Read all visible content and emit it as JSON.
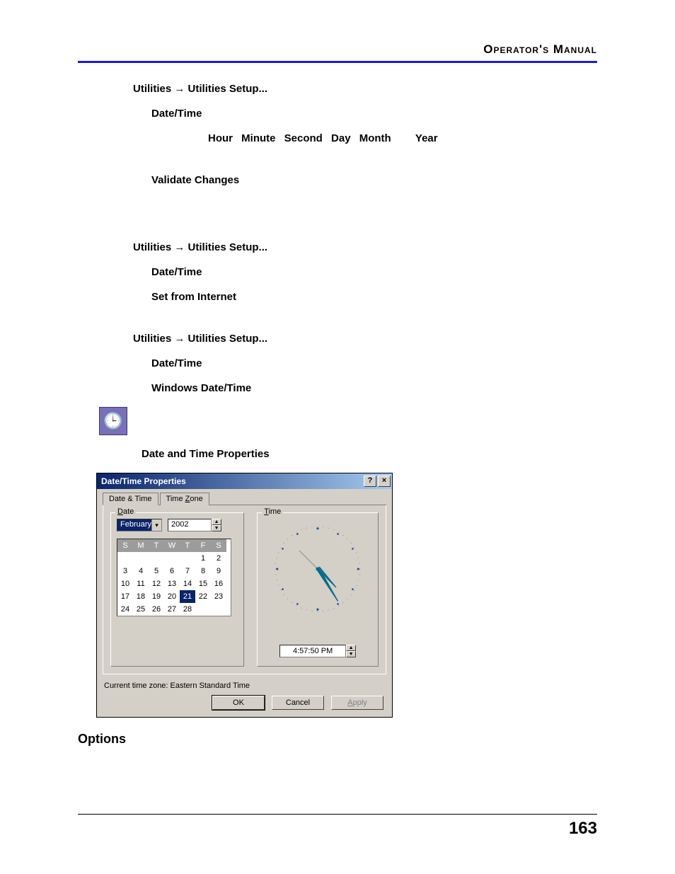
{
  "header": {
    "title": "Operator's Manual"
  },
  "footer": {
    "page_number": "163"
  },
  "section1": {
    "nav": {
      "a": "Utilities",
      "arrow": "→",
      "b": "Utilities Setup..."
    },
    "item1": "Date/Time",
    "time_parts": {
      "hour": "Hour",
      "minute": "Minute",
      "second": "Second",
      "day": "Day",
      "month": "Month",
      "year": "Year"
    },
    "validate": "Validate Changes"
  },
  "section2": {
    "nav": {
      "a": "Utilities",
      "arrow": "→",
      "b": "Utilities Setup..."
    },
    "item1": "Date/Time",
    "item2": "Set from Internet"
  },
  "section3": {
    "nav": {
      "a": "Utilities",
      "arrow": "→",
      "b": "Utilities Setup..."
    },
    "item1": "Date/Time",
    "item2": "Windows Date/Time"
  },
  "props_label": "Date and Time Properties",
  "dialog": {
    "title": "Date/Time Properties",
    "tabs": {
      "active": "Date & Time",
      "other": "Time Zone",
      "other_ul": "Z"
    },
    "date_legend": "Date",
    "date_ul": "D",
    "time_legend": "Time",
    "time_ul": "T",
    "month": "February",
    "year": "2002",
    "day_headers": [
      "S",
      "M",
      "T",
      "W",
      "T",
      "F",
      "S"
    ],
    "weeks": [
      [
        "",
        "",
        "",
        "",
        "",
        "1",
        "2"
      ],
      [
        "3",
        "4",
        "5",
        "6",
        "7",
        "8",
        "9"
      ],
      [
        "10",
        "11",
        "12",
        "13",
        "14",
        "15",
        "16"
      ],
      [
        "17",
        "18",
        "19",
        "20",
        "21",
        "22",
        "23"
      ],
      [
        "24",
        "25",
        "26",
        "27",
        "28",
        "",
        ""
      ]
    ],
    "selected_day": "21",
    "time_value": "4:57:50 PM",
    "tz_line": "Current time zone:  Eastern Standard Time",
    "buttons": {
      "ok": "OK",
      "cancel": "Cancel",
      "apply": "Apply",
      "apply_ul": "A"
    }
  },
  "options_heading": "Options"
}
